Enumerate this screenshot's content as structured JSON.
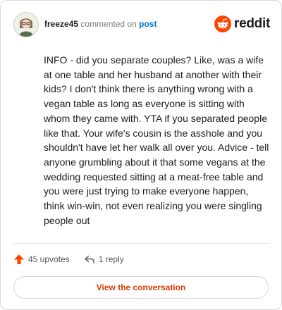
{
  "comment": {
    "username": "freeze45",
    "action": "commented on",
    "link": "post",
    "body": "INFO - did you separate couples? Like, was a wife at one table and her husband at another with their kids? I don't think there is anything wrong with a vegan table as long as everyone is sitting with whom they came with. YTA if you separated people like that. Your wife's cousin is the asshole and you shouldn't have let her walk all over you. Advice - tell anyone grumbling about it that some vegans at the wedding requested sitting at a meat-free table and you were just trying to make everyone happen, think win-win, not even realizing you were singling people out",
    "upvotes": "45 upvotes",
    "replies": "1 reply",
    "avatar_icon": "user-avatar"
  },
  "brand": {
    "name": "reddit",
    "color": "#ff4500",
    "icon": "reddit-logo-icon"
  },
  "actions": {
    "view_label": "View the conversation"
  },
  "colors": {
    "upvote": "#ff4500",
    "link": "#0079d3",
    "button_text": "#d93a00"
  }
}
